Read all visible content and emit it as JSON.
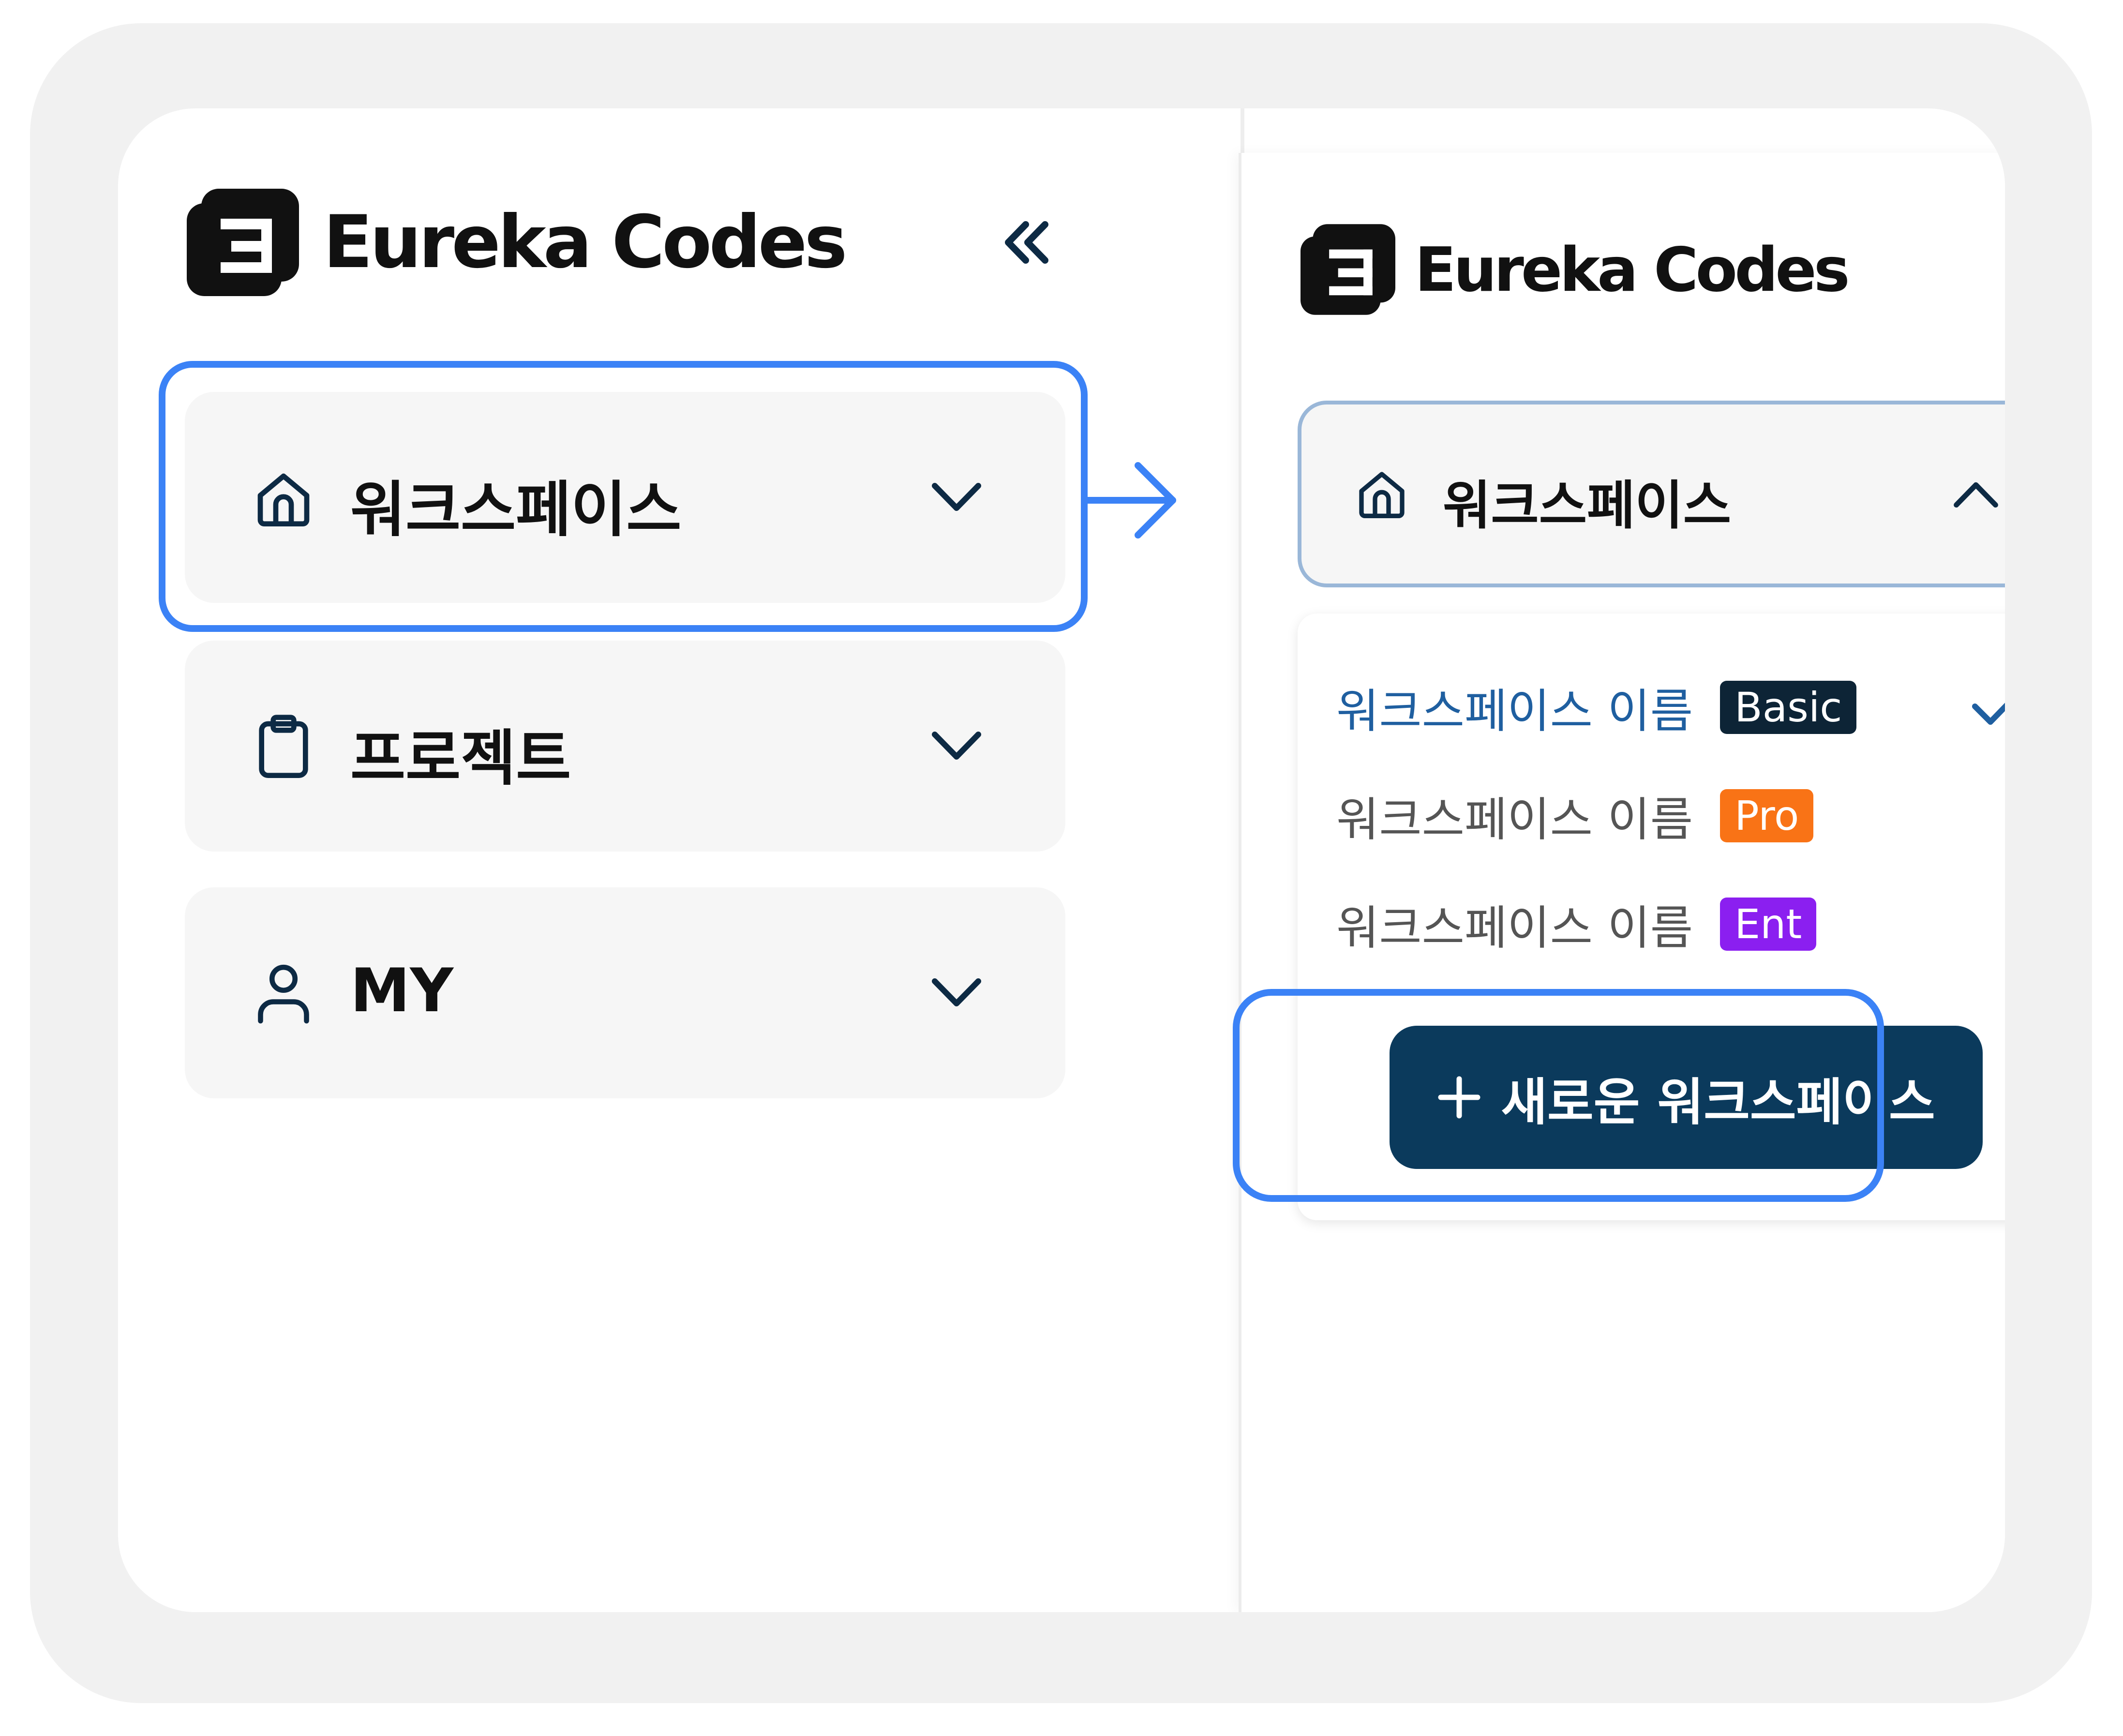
{
  "brand": {
    "name": "Eureka Codes"
  },
  "colors": {
    "accent_blue": "#3b82f6",
    "navy": "#0b3a5c",
    "selected_text": "#1f5fa0",
    "badge_basic": "#0d2436",
    "badge_pro": "#f97316",
    "badge_ent": "#8b1ff0"
  },
  "collapsed_sidebar": {
    "collapse_icon": "double-chevron-left-icon",
    "items": [
      {
        "label": "워크스페이스",
        "icon": "home-icon",
        "chevron": "chevron-down-icon"
      },
      {
        "label": "프로젝트",
        "icon": "clipboard-icon",
        "chevron": "chevron-down-icon"
      },
      {
        "label": "MY",
        "icon": "user-icon",
        "chevron": "chevron-down-icon"
      }
    ]
  },
  "expanded_sidebar": {
    "collapse_icon": "double-chevron-left-icon",
    "workspace": {
      "label": "워크스페이스",
      "icon": "home-icon",
      "chevron": "chevron-up-icon"
    },
    "workspaces": [
      {
        "name": "워크스페이스 이름",
        "badge": "Basic",
        "selected": true
      },
      {
        "name": "워크스페이스 이름",
        "badge": "Pro",
        "selected": false
      },
      {
        "name": "워크스페이스 이름",
        "badge": "Ent",
        "selected": false
      }
    ],
    "new_button": {
      "icon": "plus-icon",
      "label": "새로운 워크스페이스"
    }
  }
}
